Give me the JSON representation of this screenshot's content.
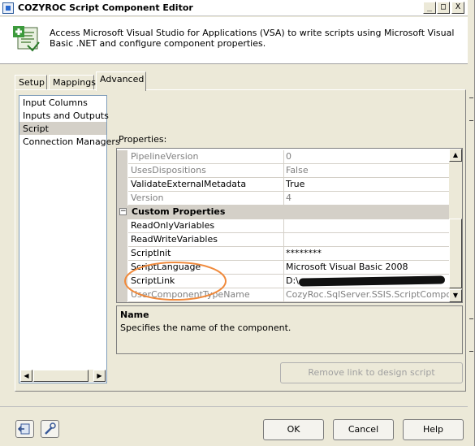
{
  "window": {
    "title": "COZYROC Script Component Editor",
    "controls": {
      "minimize": "_",
      "maximize": "□",
      "close": "X"
    }
  },
  "header": {
    "description": "Access Microsoft Visual Studio for Applications (VSA) to write scripts using Microsoft Visual Basic .NET and configure component properties.",
    "icon": "script-component-icon"
  },
  "tabs": [
    {
      "label": "Setup",
      "active": false
    },
    {
      "label": "Mappings",
      "active": false
    },
    {
      "label": "Advanced",
      "active": true
    }
  ],
  "left_list": {
    "items": [
      {
        "label": "Input Columns",
        "selected": false
      },
      {
        "label": "Inputs and Outputs",
        "selected": false
      },
      {
        "label": "Script",
        "selected": true
      },
      {
        "label": "Connection Managers",
        "selected": false
      }
    ]
  },
  "properties": {
    "label": "Properties:",
    "rows": [
      {
        "name": "PipelineVersion",
        "value": "0",
        "dim": true
      },
      {
        "name": "UsesDispositions",
        "value": "False",
        "dim": true
      },
      {
        "name": "ValidateExternalMetadata",
        "value": "True",
        "dim": false
      },
      {
        "name": "Version",
        "value": "4",
        "dim": true
      }
    ],
    "category": "Custom Properties",
    "custom_rows": [
      {
        "name": "ReadOnlyVariables",
        "value": "",
        "dim": false
      },
      {
        "name": "ReadWriteVariables",
        "value": "",
        "dim": false
      },
      {
        "name": "ScriptInit",
        "value": "********",
        "dim": false
      },
      {
        "name": "ScriptLanguage",
        "value": "Microsoft Visual Basic 2008",
        "dim": false
      },
      {
        "name": "ScriptLink",
        "value": "D:\\",
        "dim": false
      },
      {
        "name": "UserComponentTypeName",
        "value": "CozyRoc.SqlServer.SSIS.ScriptComponent",
        "dim": true
      }
    ]
  },
  "description_box": {
    "name": "Name",
    "text": "Specifies the name of the component."
  },
  "buttons": {
    "remove_link": "Remove link to design script",
    "ok": "OK",
    "cancel": "Cancel",
    "help": "Help"
  },
  "colors": {
    "annotation": "#f08a3c",
    "window_bg": "#ece9d8"
  }
}
